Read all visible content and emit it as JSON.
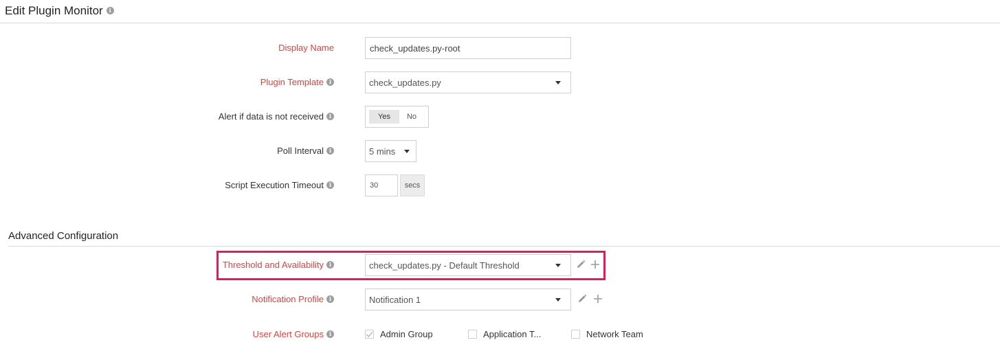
{
  "header": {
    "title": "Edit Plugin Monitor",
    "info_icon": "info-icon"
  },
  "form": {
    "display_name": {
      "label": "Display Name",
      "value": "check_updates.py-root",
      "required": true
    },
    "plugin_template": {
      "label": "Plugin Template",
      "value": "check_updates.py",
      "required": true
    },
    "alert_if_no_data": {
      "label": "Alert if data is not received",
      "yes": "Yes",
      "no": "No",
      "selected": "Yes"
    },
    "poll_interval": {
      "label": "Poll Interval",
      "value": "5 mins"
    },
    "script_timeout": {
      "label": "Script Execution Timeout",
      "value": "30",
      "unit": "secs"
    }
  },
  "advanced": {
    "title": "Advanced Configuration",
    "threshold": {
      "label": "Threshold and Availability",
      "value": "check_updates.py - Default Threshold",
      "required": true
    },
    "notification_profile": {
      "label": "Notification Profile",
      "value": "Notification 1",
      "required": true
    },
    "user_alert_groups": {
      "label": "User Alert Groups",
      "required": true,
      "options": [
        {
          "label": "Admin Group",
          "checked": true
        },
        {
          "label": "Application T...",
          "checked": false
        },
        {
          "label": "Network Team",
          "checked": false
        }
      ]
    }
  },
  "colors": {
    "required_label": "#e0413e",
    "highlight_border": "#e8185c"
  }
}
